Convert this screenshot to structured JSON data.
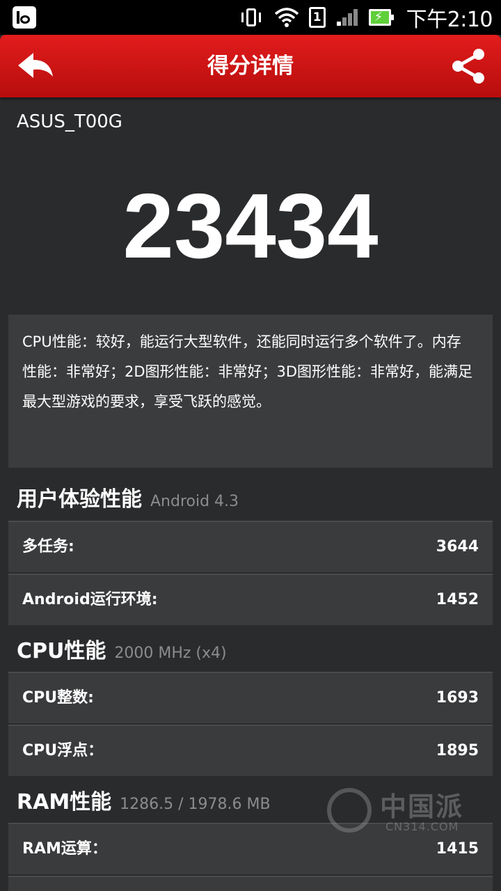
{
  "status_bar": {
    "time": "下午2:10",
    "sim_slot": "1",
    "icons": [
      "settings-toggle-icon",
      "vibrate-icon",
      "wifi-icon",
      "sim-card-icon",
      "signal-icon",
      "battery-charging-icon"
    ]
  },
  "header": {
    "title": "得分详情",
    "back_icon": "back-arrow-icon",
    "share_icon": "share-icon"
  },
  "device_name": "ASUS_T00G",
  "total_score": "23434",
  "description": "CPU性能：较好，能运行大型软件，还能同时运行多个软件了。内存性能：非常好；2D图形性能：非常好；3D图形性能：非常好，能满足最大型游戏的要求，享受飞跃的感觉。",
  "sections": [
    {
      "title": "用户体验性能",
      "subtitle": "Android 4.3",
      "rows": [
        {
          "label": "多任务:",
          "value": "3644"
        },
        {
          "label": "Android运行环境:",
          "value": "1452"
        }
      ]
    },
    {
      "title": "CPU性能",
      "subtitle": "2000 MHz (x4)",
      "rows": [
        {
          "label": "CPU整数:",
          "value": "1693"
        },
        {
          "label": "CPU浮点：",
          "value": "1895"
        }
      ]
    },
    {
      "title": "RAM性能",
      "subtitle": "1286.5 / 1978.6 MB",
      "rows": [
        {
          "label": "RAM运算：",
          "value": "1415"
        }
      ]
    }
  ],
  "watermark": {
    "text": "中国派",
    "sub": "CN314.COM"
  },
  "colors": {
    "header_red": "#d01616",
    "background": "#2a2b2d",
    "row_background": "#3a3b3d",
    "battery_green": "#5fcf3a"
  }
}
